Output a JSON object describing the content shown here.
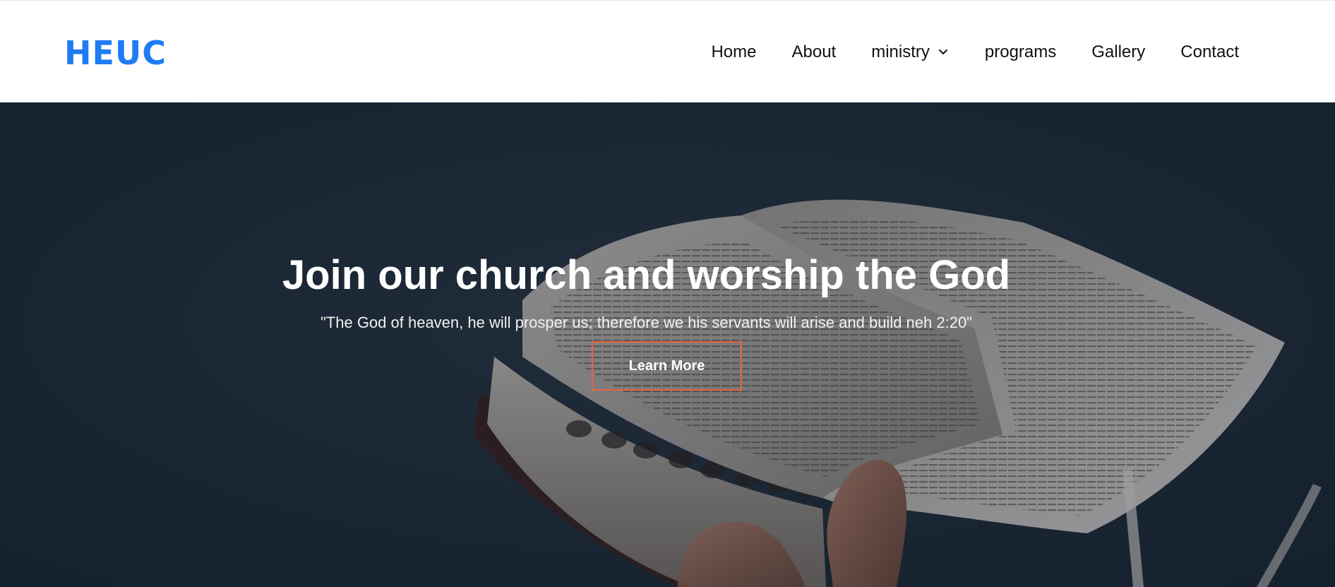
{
  "header": {
    "brand": "HEUC",
    "nav": [
      {
        "label": "Home"
      },
      {
        "label": "About"
      },
      {
        "label": "ministry",
        "has_dropdown": true
      },
      {
        "label": "programs"
      },
      {
        "label": "Gallery"
      },
      {
        "label": "Contact"
      }
    ]
  },
  "hero": {
    "title": "Join our church and worship the God",
    "subtitle": "\"The God of heaven, he will prosper us; therefore we his servants will arise and build neh 2:20\"",
    "cta_label": "Learn More"
  },
  "colors": {
    "brand": "#1f7cf2",
    "button_border": "#e8653f",
    "hero_bg": "#1d2a37"
  },
  "icons": {
    "dropdown": "chevron-down-icon",
    "hero_image": "open-bible-hand-image"
  }
}
